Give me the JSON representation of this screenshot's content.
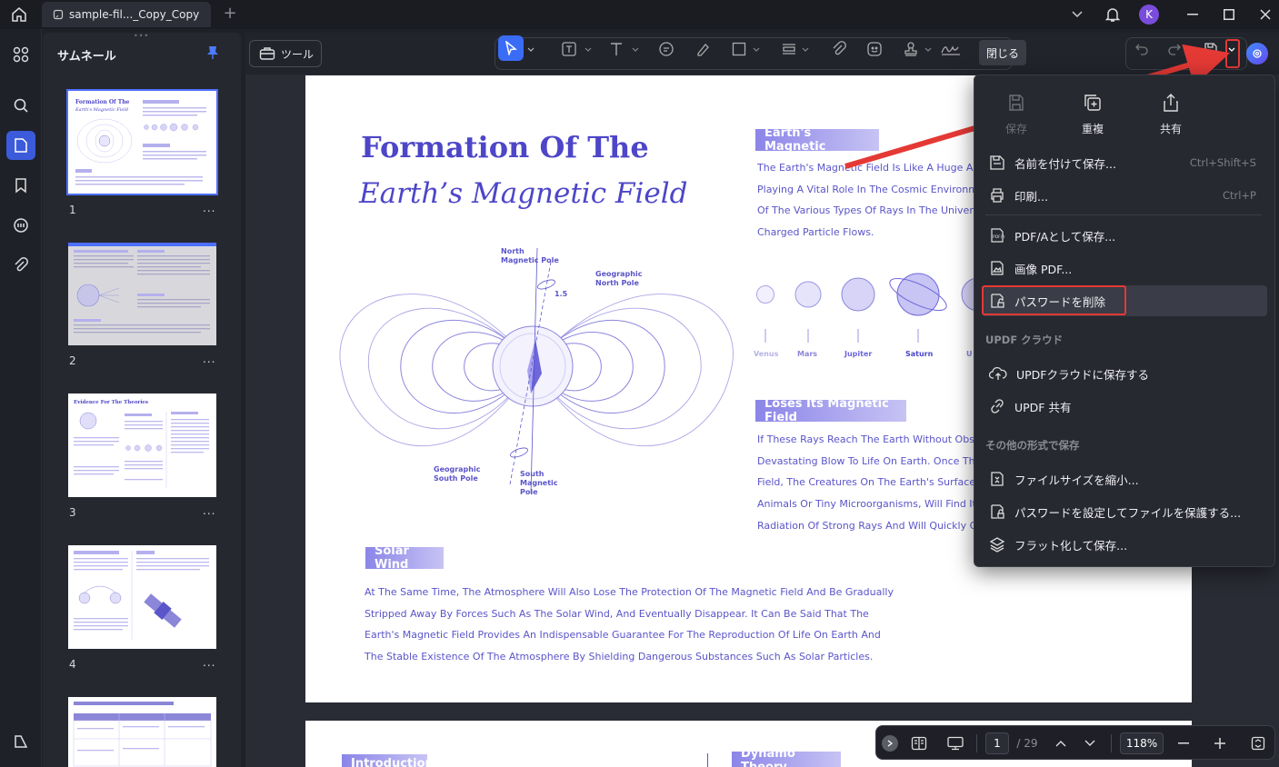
{
  "titlebar": {
    "tab_title": "sample-fil..._Copy_Copy",
    "avatar_letter": "K"
  },
  "thumbnails": {
    "title": "サムネール",
    "pages": [
      {
        "num": "1",
        "more": "..."
      },
      {
        "num": "2",
        "more": "..."
      },
      {
        "num": "3",
        "more": "..."
      },
      {
        "num": "4",
        "more": "..."
      }
    ]
  },
  "toolbar": {
    "tools_label": "ツール",
    "close_label": "閉じる"
  },
  "document": {
    "title_line1": "Formation Of The",
    "title_line2": "Earth’s Magnetic Field",
    "section1_title": "Earth's Magnetic",
    "section1_lines": [
      "The Earth's Magnetic Field Is Like A Huge And In",
      "Playing A Vital Role In The Cosmic Environment",
      "Of The Various Types Of Rays In The Universe,",
      "Charged Particle Flows."
    ],
    "planets": [
      "Venus",
      "Mars",
      "Jupiter",
      "Saturn",
      "U"
    ],
    "diagram_labels": {
      "north_magnetic": "North\nMagnetic Pole",
      "geographic_north": "Geographic\nNorth Pole",
      "angle": "1.5",
      "geographic_south": "Geographic\nSouth Pole",
      "south_magnetic": "South\nMagnetic\nPole"
    },
    "section2_title": "Loses Its Magnetic Field",
    "section2_lines": [
      "If These Rays Reach The Earth Without Obstruc",
      "Devastating Blow To Life On Earth. Once The Ea",
      "Field, The Creatures On The Earth's Surface, Wi",
      "Animals Or Tiny Microorganisms, Will Find It Diff",
      "Radiation Of Strong Rays And Will Quickly Go To"
    ],
    "section3_title": "Solar Wind",
    "section3_lines": [
      "At The Same Time, The Atmosphere Will Also Lose The Protection Of The Magnetic Field And Be Gradually",
      "Stripped Away By Forces Such As The Solar Wind, And Eventually Disappear. It Can Be Said That The",
      "Earth's Magnetic Field Provides An Indispensable Guarantee For The Reproduction Of Life On Earth And",
      "The Stable Existence Of The Atmosphere By Shielding Dangerous Substances Such As Solar Particles."
    ],
    "page2_left": "Introduction",
    "page2_right": "Dynamo Theory"
  },
  "menu": {
    "top": [
      {
        "label": "保存",
        "icon": "save-icon",
        "disabled": true
      },
      {
        "label": "重複",
        "icon": "duplicate-icon",
        "disabled": false
      },
      {
        "label": "共有",
        "icon": "share-icon",
        "disabled": false
      }
    ],
    "items": [
      {
        "label": "名前を付けて保存...",
        "shortcut": "Ctrl+Shift+S"
      },
      {
        "label": "印刷...",
        "shortcut": "Ctrl+P"
      },
      {
        "label": "PDF/Aとして保存..."
      },
      {
        "label": "画像 PDF..."
      },
      {
        "label": "パスワードを削除"
      }
    ],
    "section_cloud": "UPDF クラウド",
    "cloud_items": [
      {
        "label": "UPDFクラウドに保存する"
      },
      {
        "label": "UPDF 共有"
      }
    ],
    "section_other": "その他の形式で保存",
    "other_items": [
      {
        "label": "ファイルサイズを縮小..."
      },
      {
        "label": "パスワードを設定してファイルを保護する..."
      },
      {
        "label": "フラット化して保存..."
      }
    ]
  },
  "bottombar": {
    "current_page": "1",
    "total_pages": "/ 29",
    "zoom": "118%"
  },
  "colors": {
    "accent": "#3b6cf6",
    "highlight": "#e53935",
    "doc_purple": "#4d46c8"
  }
}
